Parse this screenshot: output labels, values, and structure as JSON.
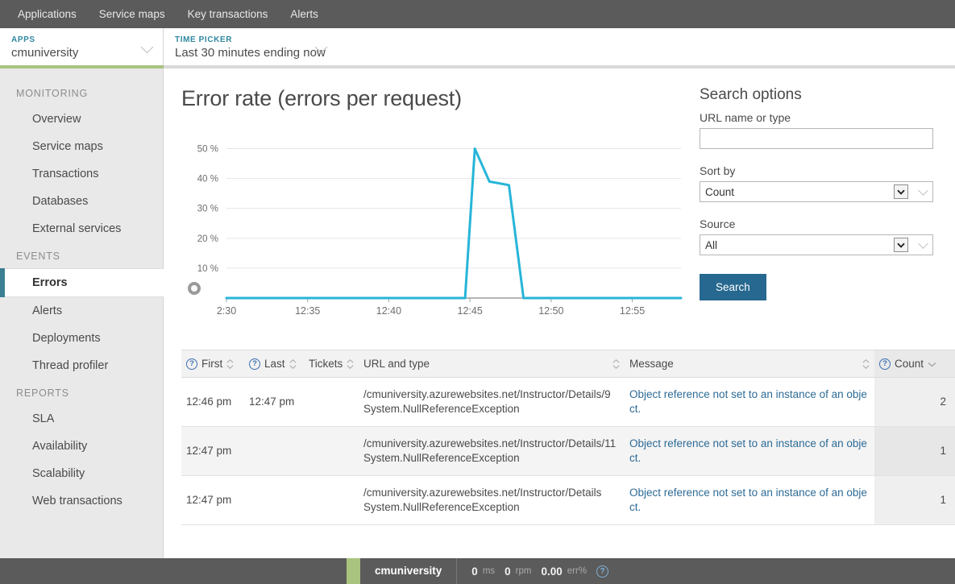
{
  "topnav": {
    "items": [
      {
        "label": "Applications"
      },
      {
        "label": "Service maps"
      },
      {
        "label": "Key transactions"
      },
      {
        "label": "Alerts"
      }
    ]
  },
  "selector_bar": {
    "apps": {
      "label": "APPS",
      "value": "cmuniversity",
      "health_color": "#a9c47f"
    },
    "time_picker": {
      "label": "TIME PICKER",
      "value": "Last 30 minutes ending now"
    }
  },
  "sidebar": {
    "groups": [
      {
        "title": "MONITORING",
        "items": [
          {
            "label": "Overview",
            "active": false
          },
          {
            "label": "Service maps",
            "active": false
          },
          {
            "label": "Transactions",
            "active": false
          },
          {
            "label": "Databases",
            "active": false
          },
          {
            "label": "External services",
            "active": false
          }
        ]
      },
      {
        "title": "EVENTS",
        "items": [
          {
            "label": "Errors",
            "active": true
          },
          {
            "label": "Alerts",
            "active": false
          },
          {
            "label": "Deployments",
            "active": false
          },
          {
            "label": "Thread profiler",
            "active": false
          }
        ]
      },
      {
        "title": "REPORTS",
        "items": [
          {
            "label": "SLA",
            "active": false
          },
          {
            "label": "Availability",
            "active": false
          },
          {
            "label": "Scalability",
            "active": false
          },
          {
            "label": "Web transactions",
            "active": false
          }
        ]
      }
    ]
  },
  "chart_data": {
    "type": "line",
    "title": "Error rate (errors per request)",
    "xlabel": "",
    "ylabel": "",
    "ylim": [
      0,
      55
    ],
    "ytick_labels": [
      "50 %",
      "40 %",
      "30 %",
      "20 %",
      "10 %"
    ],
    "ytick_values": [
      50,
      40,
      30,
      20,
      10
    ],
    "xtick_labels": [
      "2:30",
      "12:35",
      "12:40",
      "12:45",
      "12:50",
      "12:55"
    ],
    "xtick_minutes": [
      30,
      35,
      40,
      45,
      50,
      55
    ],
    "xlim_minutes": [
      30,
      58
    ],
    "grid": true,
    "legend": null,
    "line_color": "#27b5d8",
    "series": [
      {
        "name": "Error rate",
        "x": [
          30,
          31,
          32,
          33,
          34,
          35,
          36,
          37,
          38,
          39,
          40,
          41,
          42,
          43,
          44,
          44.7,
          45.3,
          46.2,
          47.4,
          48.3,
          49,
          50,
          51,
          52,
          53,
          54,
          55,
          56,
          57,
          58
        ],
        "values": [
          0,
          0,
          0,
          0,
          0,
          0,
          0,
          0,
          0,
          0,
          0,
          0,
          0,
          0,
          0,
          0,
          50,
          39,
          37.8,
          0,
          0,
          0,
          0,
          0,
          0,
          0,
          0,
          0,
          0,
          0
        ]
      }
    ],
    "slider_handle": true
  },
  "search_options": {
    "title": "Search options",
    "url_field": {
      "label": "URL name or type",
      "value": "",
      "placeholder": ""
    },
    "sort_by": {
      "label": "Sort by",
      "value": "Count"
    },
    "source": {
      "label": "Source",
      "value": "All"
    },
    "search_button": "Search",
    "button_color": "#26688f"
  },
  "table": {
    "columns": [
      {
        "label": "First",
        "help": true,
        "sort": "both"
      },
      {
        "label": "Last",
        "help": true,
        "sort": "both"
      },
      {
        "label": "Tickets",
        "help": false,
        "sort": "both"
      },
      {
        "label": "URL and type",
        "help": false,
        "sort": "both"
      },
      {
        "label": "Message",
        "help": false,
        "sort": "both"
      },
      {
        "label": "Count",
        "help": true,
        "sort": "down"
      }
    ],
    "rows": [
      {
        "first": "12:46 pm",
        "last": "12:47 pm",
        "tickets": "",
        "url": "/cmuniversity.azurewebsites.net/Instructor/Details/9",
        "type": "System.NullReferenceException",
        "message": "Object reference not set to an instance of an object.",
        "count": "2"
      },
      {
        "first": "12:47 pm",
        "last": "",
        "tickets": "",
        "url": "/cmuniversity.azurewebsites.net/Instructor/Details/11",
        "type": "System.NullReferenceException",
        "message": "Object reference not set to an instance of an object.",
        "count": "1"
      },
      {
        "first": "12:47 pm",
        "last": "",
        "tickets": "",
        "url": "/cmuniversity.azurewebsites.net/Instructor/Details",
        "type": "System.NullReferenceException",
        "message": "Object reference not set to an instance of an object.",
        "count": "1"
      }
    ]
  },
  "footer": {
    "app_name": "cmuniversity",
    "health_color": "#a9c47f",
    "metrics": [
      {
        "value": "0",
        "unit": "ms"
      },
      {
        "value": "0",
        "unit": "rpm"
      },
      {
        "value": "0.00",
        "unit": "err%"
      }
    ],
    "help": "?"
  }
}
